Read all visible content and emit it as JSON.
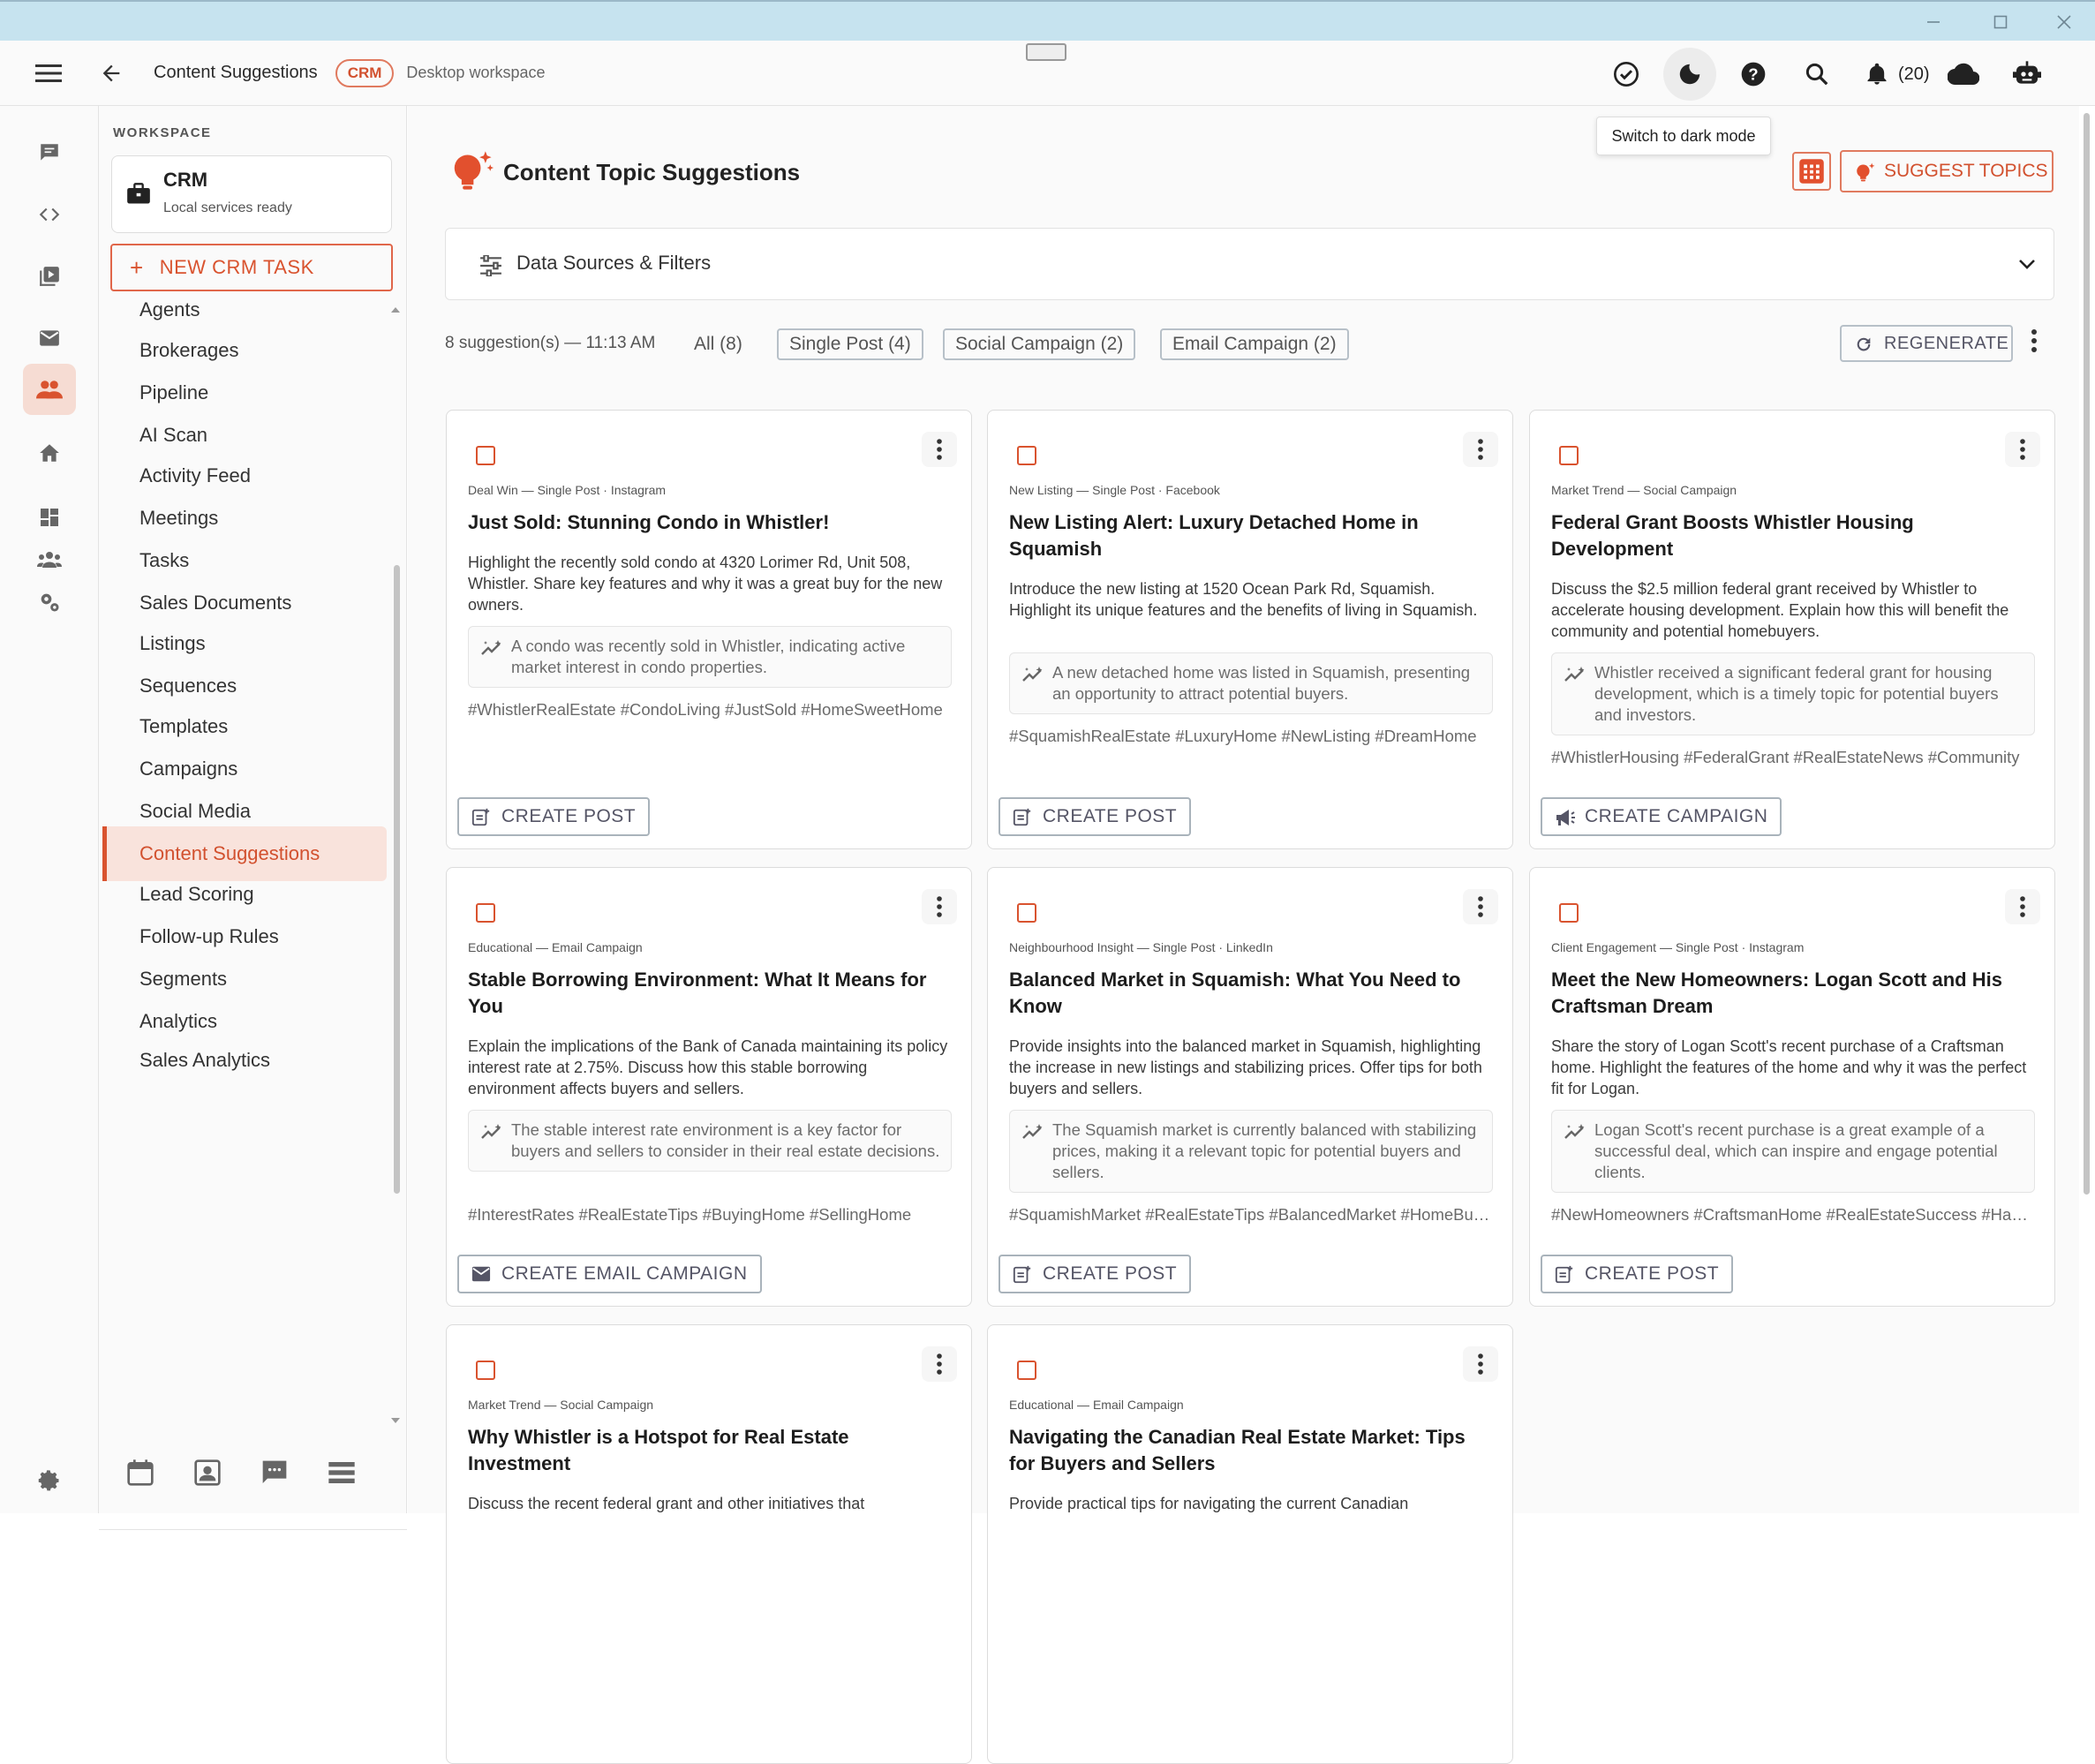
{
  "appbar": {
    "title": "Content Suggestions",
    "badge": "CRM",
    "workspace_label": "Desktop workspace",
    "notification_count": "(20)"
  },
  "tooltip": "Switch to dark mode",
  "sidebar": {
    "section_label": "WORKSPACE",
    "workspace_name": "CRM",
    "workspace_status": "Local services ready",
    "new_task_label": "NEW CRM TASK",
    "items": [
      {
        "label": "Agents"
      },
      {
        "label": "Brokerages"
      },
      {
        "label": "Pipeline"
      },
      {
        "label": "AI Scan"
      },
      {
        "label": "Activity Feed"
      },
      {
        "label": "Meetings"
      },
      {
        "label": "Tasks"
      },
      {
        "label": "Sales Documents"
      },
      {
        "label": "Listings"
      },
      {
        "label": "Sequences"
      },
      {
        "label": "Templates"
      },
      {
        "label": "Campaigns"
      },
      {
        "label": "Social Media"
      },
      {
        "label": "Content Suggestions"
      },
      {
        "label": "Lead Scoring"
      },
      {
        "label": "Follow-up Rules"
      },
      {
        "label": "Segments"
      },
      {
        "label": "Analytics"
      },
      {
        "label": "Sales Analytics"
      }
    ],
    "active_item": "Content Suggestions"
  },
  "main": {
    "title": "Content Topic Suggestions",
    "suggest_button": "SUGGEST TOPICS",
    "filters_label": "Data Sources & Filters",
    "summary": "8 suggestion(s) — 11:13 AM",
    "chips": [
      "All (8)",
      "Single Post (4)",
      "Social Campaign (2)",
      "Email Campaign (2)"
    ],
    "regenerate_label": "REGENERATE"
  },
  "cards": [
    {
      "meta": "Deal Win — Single Post · Instagram",
      "title": "Just Sold: Stunning Condo in Whistler!",
      "description": "Highlight the recently sold condo at 4320 Lorimer Rd, Unit 508, Whistler. Share key features and why it was a great buy for the new owners.",
      "insight": "A condo was recently sold in Whistler, indicating active market interest in condo properties.",
      "tags": "#WhistlerRealEstate #CondoLiving #JustSold #HomeSweetHome",
      "action": "CREATE POST",
      "action_icon": "post-add-icon"
    },
    {
      "meta": "New Listing — Single Post · Facebook",
      "title": "New Listing Alert: Luxury Detached Home in Squamish",
      "description": "Introduce the new listing at 1520 Ocean Park Rd, Squamish. Highlight its unique features and the benefits of living in Squamish.",
      "insight": "A new detached home was listed in Squamish, presenting an opportunity to attract potential buyers.",
      "tags": "#SquamishRealEstate #LuxuryHome #NewListing #DreamHome",
      "action": "CREATE POST",
      "action_icon": "post-add-icon"
    },
    {
      "meta": "Market Trend — Social Campaign",
      "title": "Federal Grant Boosts Whistler Housing Development",
      "description": "Discuss the $2.5 million federal grant received by Whistler to accelerate housing development. Explain how this will benefit the community and potential homebuyers.",
      "insight": "Whistler received a significant federal grant for housing development, which is a timely topic for potential buyers and investors.",
      "tags": "#WhistlerHousing #FederalGrant #RealEstateNews #Community",
      "action": "CREATE CAMPAIGN",
      "action_icon": "megaphone-icon"
    },
    {
      "meta": "Educational — Email Campaign",
      "title": "Stable Borrowing Environment: What It Means for You",
      "description": "Explain the implications of the Bank of Canada maintaining its policy interest rate at 2.75%. Discuss how this stable borrowing environment affects buyers and sellers.",
      "insight": "The stable interest rate environment is a key factor for buyers and sellers to consider in their real estate decisions.",
      "tags": "#InterestRates #RealEstateTips #BuyingHome #SellingHome",
      "action": "CREATE EMAIL CAMPAIGN",
      "action_icon": "mail-icon"
    },
    {
      "meta": "Neighbourhood Insight — Single Post · LinkedIn",
      "title": "Balanced Market in Squamish: What You Need to Know",
      "description": "Provide insights into the balanced market in Squamish, highlighting the increase in new listings and stabilizing prices. Offer tips for both buyers and sellers.",
      "insight": "The Squamish market is currently balanced with stabilizing prices, making it a relevant topic for potential buyers and sellers.",
      "tags": "#SquamishMarket #RealEstateTips #BalancedMarket #HomeBuying",
      "action": "CREATE POST",
      "action_icon": "post-add-icon"
    },
    {
      "meta": "Client Engagement — Single Post · Instagram",
      "title": "Meet the New Homeowners: Logan Scott and His Craftsman Dream",
      "description": "Share the story of Logan Scott's recent purchase of a Craftsman home. Highlight the features of the home and why it was the perfect fit for Logan.",
      "insight": "Logan Scott's recent purchase is a great example of a successful deal, which can inspire and engage potential clients.",
      "tags": "#NewHomeowners #CraftsmanHome #RealEstateSuccess #HappyClients",
      "action": "CREATE POST",
      "action_icon": "post-add-icon"
    },
    {
      "meta": "Market Trend — Social Campaign",
      "title": "Why Whistler is a Hotspot for Real Estate Investment",
      "description": "Discuss the recent federal grant and other initiatives that",
      "insight": "",
      "tags": "",
      "action": "",
      "action_icon": ""
    },
    {
      "meta": "Educational — Email Campaign",
      "title": "Navigating the Canadian Real Estate Market: Tips for Buyers and Sellers",
      "description": "Provide practical tips for navigating the current Canadian",
      "insight": "",
      "tags": "",
      "action": "",
      "action_icon": ""
    }
  ],
  "colors": {
    "accent": "#d9532f",
    "titlebar": "#c6e3ef",
    "active_bg": "#f9e3dc"
  }
}
